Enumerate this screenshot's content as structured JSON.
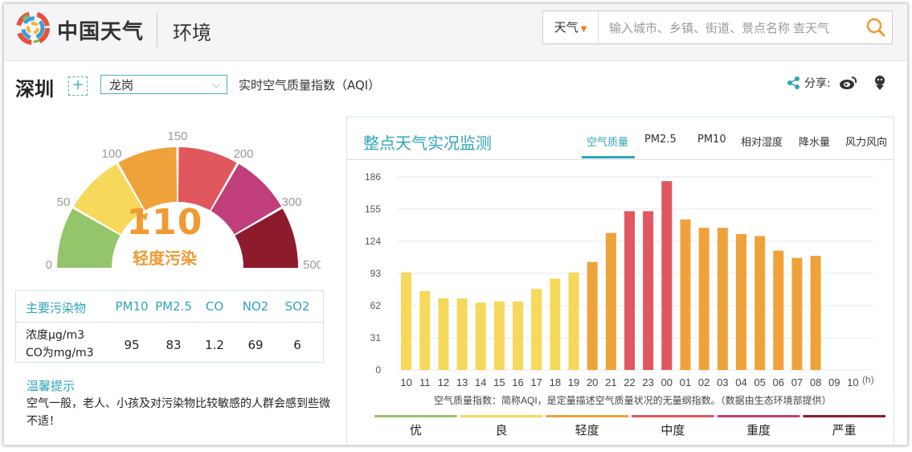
{
  "header": {
    "brand": "中国天气",
    "section": "环境",
    "search": {
      "type": "天气",
      "placeholder": "输入城市、乡镇、街道、景点名称 查天气"
    }
  },
  "location": {
    "city": "深圳",
    "add": "+",
    "district": "龙岗",
    "aqi_title": "实时空气质量指数（AQI）",
    "share_label": "分享:"
  },
  "gauge": {
    "value": "110",
    "level": "轻度污染",
    "scale_labels": [
      "0",
      "50",
      "100",
      "150",
      "200",
      "300",
      "500"
    ],
    "segment_colors": [
      "#95c56a",
      "#f6d85a",
      "#f0a23a",
      "#e0575e",
      "#c03f7a",
      "#8e1b2c"
    ],
    "value_color": "#f09a33"
  },
  "pollutants": {
    "header_label": "主要污染物",
    "columns": [
      "PM10",
      "PM2.5",
      "CO",
      "NO2",
      "SO2"
    ],
    "row_label_1": "浓度μg/m3",
    "row_label_2": "CO为mg/m3",
    "values": [
      "95",
      "83",
      "1.2",
      "69",
      "6"
    ]
  },
  "tip": {
    "title": "温馨提示",
    "text": "空气一般，老人、小孩及对污染物比较敏感的人群会感到些微不适！"
  },
  "panel": {
    "title": "整点天气实况监测",
    "tabs": [
      "空气质量",
      "PM2.5",
      "PM10",
      "相对湿度",
      "降水量",
      "风力风向"
    ],
    "active_tab": 0,
    "note": "空气质量指数：简称AQI，是定量描述空气质量状况的无量纲指数。（数据由生态环境部提供）",
    "legend": [
      {
        "label": "优",
        "color": "#95c56a"
      },
      {
        "label": "良",
        "color": "#f6d85a"
      },
      {
        "label": "轻度",
        "color": "#f0a23a"
      },
      {
        "label": "中度",
        "color": "#e0575e"
      },
      {
        "label": "重度",
        "color": "#c03f7a"
      },
      {
        "label": "严重",
        "color": "#8e1b2c"
      }
    ]
  },
  "chart_data": {
    "type": "bar",
    "title": "",
    "xlabel": "",
    "ylabel": "",
    "x_unit": "(h)",
    "categories": [
      "10",
      "11",
      "12",
      "13",
      "14",
      "15",
      "16",
      "17",
      "18",
      "19",
      "20",
      "21",
      "22",
      "23",
      "00",
      "01",
      "02",
      "03",
      "04",
      "05",
      "06",
      "07",
      "08",
      "09",
      "10"
    ],
    "values": [
      94,
      76,
      69,
      69,
      65,
      66,
      66,
      78,
      88,
      94,
      104,
      132,
      153,
      153,
      182,
      145,
      137,
      137,
      131,
      129,
      115,
      108,
      110,
      null,
      null
    ],
    "yticks": [
      0,
      31,
      62,
      93,
      124,
      155,
      186
    ],
    "ylim": [
      0,
      186
    ],
    "grid": true,
    "level_colors": {
      "good": "#f6d85a",
      "light": "#f0a23a",
      "moderate": "#e0575e"
    }
  }
}
